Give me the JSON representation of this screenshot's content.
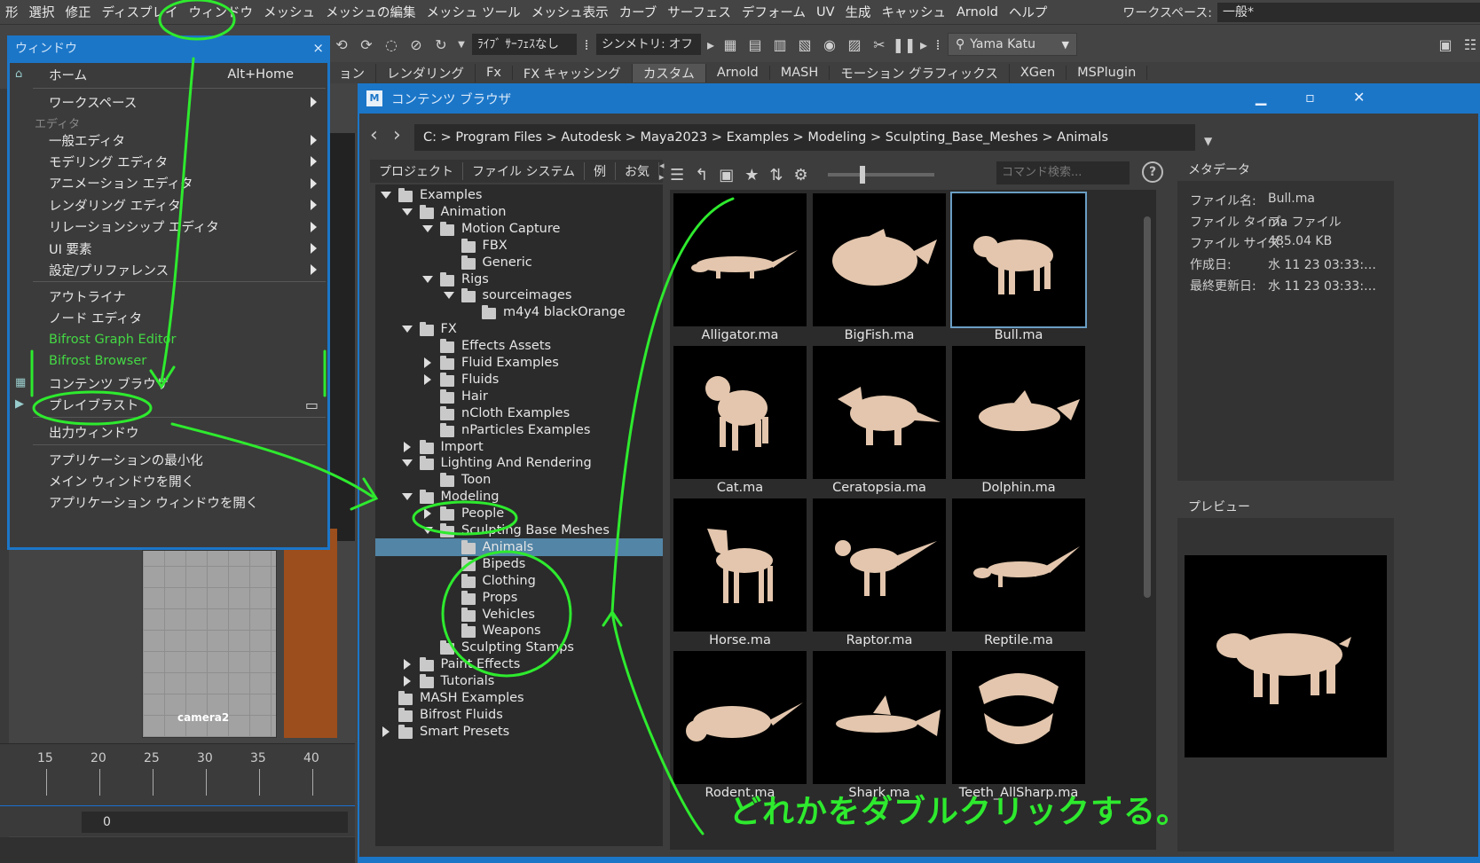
{
  "menubar": {
    "items": [
      "形",
      "選択",
      "修正",
      "ディスプレイ",
      "ウィンドウ",
      "メッシュ",
      "メッシュの編集",
      "メッシュ ツール",
      "メッシュ表示",
      "カーブ",
      "サーフェス",
      "デフォーム",
      "UV",
      "生成",
      "キャッシュ",
      "Arnold",
      "ヘルプ"
    ],
    "workspace_label": "ワークスペース:",
    "workspace_value": "一般*"
  },
  "toolbar": {
    "live_surface": "ﾗｲﾌﾞ ｻｰﾌｪｽなし",
    "symmetry": "シンメトリ: オフ",
    "user": "Yama Katu"
  },
  "shelf": {
    "tabs": [
      "ョン",
      "レンダリング",
      "Fx",
      "FX キャッシング",
      "カスタム",
      "Arnold",
      "MASH",
      "モーション グラフィックス",
      "XGen",
      "MSPlugin"
    ]
  },
  "window_menu": {
    "title": "ウィンドウ",
    "close": "×",
    "home": "ホーム",
    "home_shortcut": "Alt+Home",
    "workspace": "ワークスペース",
    "section_editors": "エディタ",
    "editors": [
      "一般エディタ",
      "モデリング エディタ",
      "アニメーション エディタ",
      "レンダリング エディタ",
      "リレーションシップ エディタ",
      "UI 要素",
      "設定/プリファレンス"
    ],
    "outliner": "アウトライナ",
    "node_editor": "ノード エディタ",
    "bifrost_graph": "Bifrost Graph Editor",
    "bifrost_browser": "Bifrost Browser",
    "content_browser": "コンテンツ ブラウザ",
    "playblast": "プレイブラスト",
    "output_window": "出力ウィンドウ",
    "minimize": "アプリケーションの最小化",
    "open_main": "メイン ウィンドウを開く",
    "open_app": "アプリケーション ウィンドウを開く"
  },
  "viewport": {
    "camera": "camera2",
    "timeline_ticks": [
      "15",
      "20",
      "25",
      "30",
      "35",
      "40"
    ],
    "range_value": "0"
  },
  "content_browser": {
    "title": "コンテンツ ブラウザ",
    "path": "C:  > Program Files > Autodesk > Maya2023 > Examples > Modeling > Sculpting_Base_Meshes > Animals",
    "tabs": [
      "プロジェクト",
      "ファイル システム",
      "例",
      "お気"
    ],
    "command_placeholder": "コマンド検索...",
    "tree": [
      {
        "label": "Examples",
        "level": 0,
        "toggle": "down"
      },
      {
        "label": "Animation",
        "level": 1,
        "toggle": "down"
      },
      {
        "label": "Motion Capture",
        "level": 2,
        "toggle": "down"
      },
      {
        "label": "FBX",
        "level": 3,
        "toggle": ""
      },
      {
        "label": "Generic",
        "level": 3,
        "toggle": ""
      },
      {
        "label": "Rigs",
        "level": 2,
        "toggle": "down"
      },
      {
        "label": "sourceimages",
        "level": 3,
        "toggle": "down"
      },
      {
        "label": "m4y4 blackOrange",
        "level": 4,
        "toggle": ""
      },
      {
        "label": "FX",
        "level": 1,
        "toggle": "down"
      },
      {
        "label": "Effects Assets",
        "level": 2,
        "toggle": ""
      },
      {
        "label": "Fluid Examples",
        "level": 2,
        "toggle": "right"
      },
      {
        "label": "Fluids",
        "level": 2,
        "toggle": "right"
      },
      {
        "label": "Hair",
        "level": 2,
        "toggle": ""
      },
      {
        "label": "nCloth Examples",
        "level": 2,
        "toggle": ""
      },
      {
        "label": "nParticles Examples",
        "level": 2,
        "toggle": ""
      },
      {
        "label": "Import",
        "level": 1,
        "toggle": "right"
      },
      {
        "label": "Lighting And Rendering",
        "level": 1,
        "toggle": "down"
      },
      {
        "label": "Toon",
        "level": 2,
        "toggle": ""
      },
      {
        "label": "Modeling",
        "level": 1,
        "toggle": "down"
      },
      {
        "label": "People",
        "level": 2,
        "toggle": "right"
      },
      {
        "label": "Sculpting Base Meshes",
        "level": 2,
        "toggle": "down"
      },
      {
        "label": "Animals",
        "level": 3,
        "toggle": "",
        "selected": true
      },
      {
        "label": "Bipeds",
        "level": 3,
        "toggle": ""
      },
      {
        "label": "Clothing",
        "level": 3,
        "toggle": ""
      },
      {
        "label": "Props",
        "level": 3,
        "toggle": ""
      },
      {
        "label": "Vehicles",
        "level": 3,
        "toggle": ""
      },
      {
        "label": "Weapons",
        "level": 3,
        "toggle": ""
      },
      {
        "label": "Sculpting Stamps",
        "level": 2,
        "toggle": ""
      },
      {
        "label": "Paint Effects",
        "level": 1,
        "toggle": "right"
      },
      {
        "label": "Tutorials",
        "level": 1,
        "toggle": "right"
      },
      {
        "label": "MASH Examples",
        "level": 0,
        "toggle": ""
      },
      {
        "label": "Bifrost Fluids",
        "level": 0,
        "toggle": ""
      },
      {
        "label": "Smart Presets",
        "level": 0,
        "toggle": "right"
      }
    ],
    "files": [
      "Alligator.ma",
      "BigFish.ma",
      "Bull.ma",
      "Cat.ma",
      "Ceratopsia.ma",
      "Dolphin.ma",
      "Horse.ma",
      "Raptor.ma",
      "Reptile.ma",
      "Rodent.ma",
      "Shark.ma",
      "Teeth_AllSharp.ma"
    ],
    "selected_file": "Bull.ma",
    "metadata_header": "メタデータ",
    "metadata": [
      {
        "k": "ファイル名:",
        "v": "Bull.ma"
      },
      {
        "k": "ファイル タイプ:",
        "v": "ma ファイル"
      },
      {
        "k": "ファイル サイズ:",
        "v": "485.04 KB"
      },
      {
        "k": "作成日:",
        "v": "水 11 23 03:33:…"
      },
      {
        "k": "最終更新日:",
        "v": "水 11 23 03:33:…"
      }
    ],
    "preview_header": "プレビュー"
  },
  "annotation": {
    "text": "どれかをダブルクリックする。",
    "color": "#2eea2e"
  },
  "colors": {
    "accent": "#1b76c8",
    "selection": "#5285a6",
    "model": "#e3c6ad"
  }
}
